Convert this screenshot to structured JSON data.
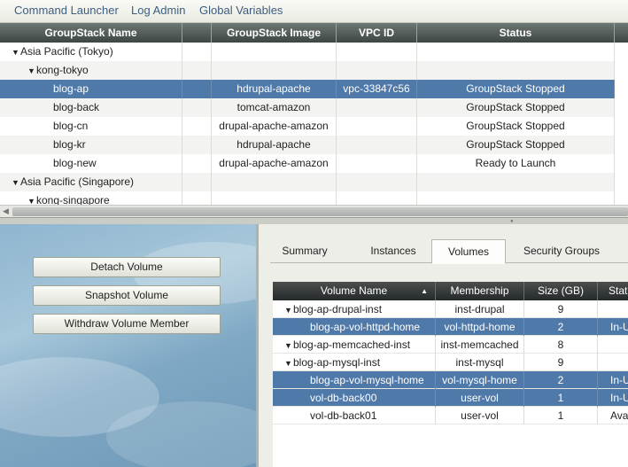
{
  "menu": [
    "Command Launcher",
    "Log Admin",
    "Global Variables"
  ],
  "groupstack_table": {
    "columns": [
      "GroupStack Name",
      "GroupStack Image",
      "VPC ID",
      "Status"
    ],
    "rows": [
      {
        "name": "Asia Pacific (Tokyo)",
        "image": "",
        "vpc": "",
        "status": "",
        "level": 0,
        "expanded": true
      },
      {
        "name": "kong-tokyo",
        "image": "",
        "vpc": "",
        "status": "",
        "level": 1,
        "expanded": true
      },
      {
        "name": "blog-ap",
        "image": "hdrupal-apache",
        "vpc": "vpc-33847c56",
        "status": "GroupStack Stopped",
        "level": 2,
        "selected": true
      },
      {
        "name": "blog-back",
        "image": "tomcat-amazon",
        "vpc": "",
        "status": "GroupStack Stopped",
        "level": 2
      },
      {
        "name": "blog-cn",
        "image": "drupal-apache-amazon",
        "vpc": "",
        "status": "GroupStack Stopped",
        "level": 2
      },
      {
        "name": "blog-kr",
        "image": "hdrupal-apache",
        "vpc": "",
        "status": "GroupStack Stopped",
        "level": 2
      },
      {
        "name": "blog-new",
        "image": "drupal-apache-amazon",
        "vpc": "",
        "status": "Ready to Launch",
        "level": 2
      },
      {
        "name": "Asia Pacific (Singapore)",
        "image": "",
        "vpc": "",
        "status": "",
        "level": 0,
        "expanded": true
      },
      {
        "name": "kong-singapore",
        "image": "",
        "vpc": "",
        "status": "",
        "level": 1,
        "expanded": true
      }
    ]
  },
  "actions": [
    "Detach Volume",
    "Snapshot Volume",
    "Withdraw Volume Member"
  ],
  "tabs": [
    "Summary",
    "Instances",
    "Volumes",
    "Security Groups"
  ],
  "active_tab": "Volumes",
  "volume_table": {
    "columns": [
      "Volume Name",
      "Membership",
      "Size (GB)",
      "Stat"
    ],
    "sort_icon": "sort-ascending-icon",
    "rows": [
      {
        "name": "blog-ap-drupal-inst",
        "membership": "inst-drupal",
        "size": "9",
        "status": "",
        "level": 0,
        "expanded": true
      },
      {
        "name": "blog-ap-vol-httpd-home",
        "membership": "vol-httpd-home",
        "size": "2",
        "status": "In-U",
        "level": 1,
        "selected": true
      },
      {
        "name": "blog-ap-memcached-inst",
        "membership": "inst-memcached",
        "size": "8",
        "status": "",
        "level": 0,
        "expanded": true
      },
      {
        "name": "blog-ap-mysql-inst",
        "membership": "inst-mysql",
        "size": "9",
        "status": "",
        "level": 0,
        "expanded": true
      },
      {
        "name": "blog-ap-vol-mysql-home",
        "membership": "vol-mysql-home",
        "size": "2",
        "status": "In-U",
        "level": 1,
        "selected": true
      },
      {
        "name": "vol-db-back00",
        "membership": "user-vol",
        "size": "1",
        "status": "In-U",
        "level": 1,
        "selected": true
      },
      {
        "name": "vol-db-back01",
        "membership": "user-vol",
        "size": "1",
        "status": "Avail",
        "level": 1
      }
    ]
  },
  "colors": {
    "selection": "#4f79a9",
    "menu_text": "#3c5e80",
    "header_dark": "#3e4643"
  }
}
